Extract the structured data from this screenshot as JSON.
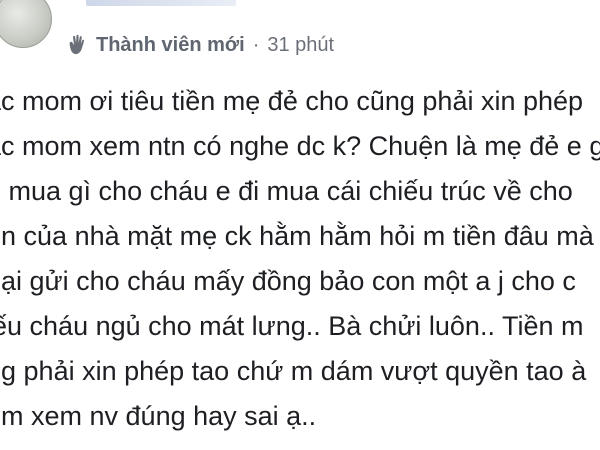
{
  "post": {
    "badge": "Thành viên mới",
    "separator": "·",
    "time": "31 phút",
    "icon": "wave-hand-icon",
    "lines": [
      "ác mom ơi tiêu tiền mẹ đẻ cho cũng phải xin phép",
      "ác mom xem ntn có nghe dc k? Chuện là mẹ đẻ e g",
      "o mua gì cho cháu e đi mua cái chiếu trúc về cho",
      "ền của nhà mặt mẹ ck hằm hằm hỏi m tiền đâu mà",
      "oại gửi cho cháu mấy đồng bảo con một a j cho c",
      "iếu cháu ngủ cho mát lưng.. Bà chửi luôn.. Tiền m",
      "ng phải xin phép tao chứ m dám vượt quyền tao à",
      "om xem nv đúng hay sai ạ.."
    ]
  }
}
